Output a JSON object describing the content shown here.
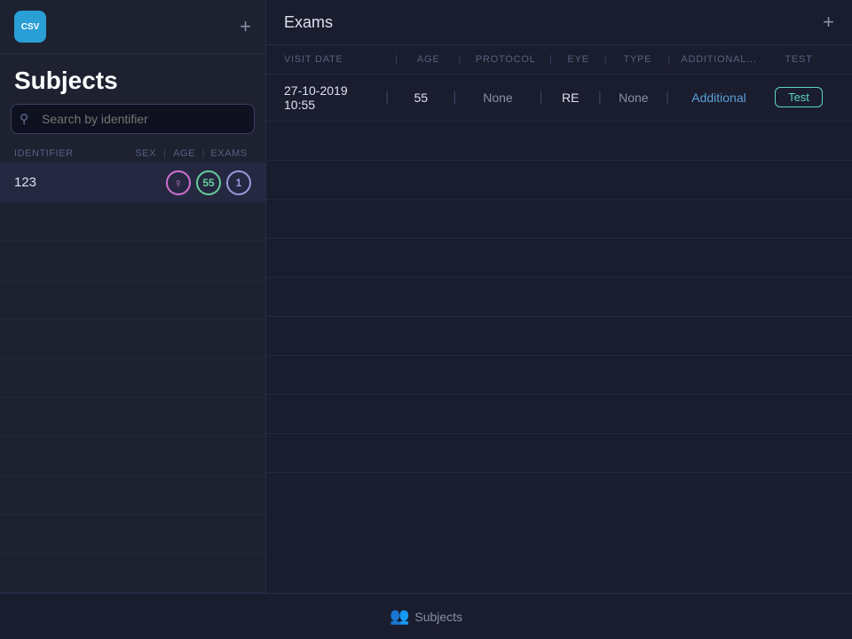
{
  "app": {
    "logo_text": "CSV",
    "title": "Subjects"
  },
  "sidebar": {
    "add_button_label": "+",
    "title": "Subjects",
    "search_placeholder": "Search by identifier",
    "list_header": {
      "identifier": "IDENTIFIER",
      "sex": "SEX",
      "age": "AGE",
      "exams": "EXAMS"
    },
    "subjects": [
      {
        "id": "123",
        "gender_icon": "♀",
        "age": "55",
        "exams_count": "1"
      }
    ]
  },
  "exams": {
    "title": "Exams",
    "add_button_label": "+",
    "table_header": {
      "visit_date": "VISIT DATE",
      "age": "AGE",
      "protocol": "PROTOCOL",
      "eye": "EYE",
      "type": "TYPE",
      "additional": "ADDITIONAL...",
      "test": "TEST"
    },
    "rows": [
      {
        "visit_date": "27-10-2019 10:55",
        "age": "55",
        "protocol": "None",
        "eye": "RE",
        "type": "None",
        "additional": "Additional",
        "test_label": "Test"
      }
    ]
  },
  "bottom_nav": {
    "icon": "👥",
    "label": "Subjects"
  }
}
